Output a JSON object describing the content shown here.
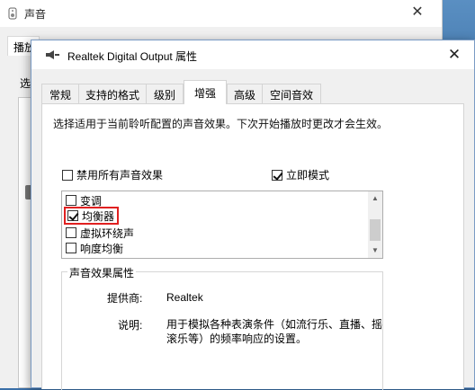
{
  "background_window": {
    "title": "声音",
    "tab_label": "播放",
    "label": "选"
  },
  "dialog": {
    "title": "Realtek Digital Output 属性",
    "tabs": [
      {
        "label": "常规",
        "active": false
      },
      {
        "label": "支持的格式",
        "active": false
      },
      {
        "label": "级别",
        "active": false
      },
      {
        "label": "增强",
        "active": true
      },
      {
        "label": "高级",
        "active": false
      },
      {
        "label": "空间音效",
        "active": false
      }
    ],
    "description": "选择适用于当前聆听配置的声音效果。下次开始播放时更改才会生效。",
    "disable_all": {
      "label": "禁用所有声音效果",
      "checked": false
    },
    "immediate_mode": {
      "label": "立即模式",
      "checked": true
    },
    "effects": [
      {
        "label": "变调",
        "checked": false
      },
      {
        "label": "均衡器",
        "checked": true
      },
      {
        "label": "虚拟环绕声",
        "checked": false
      },
      {
        "label": "响度均衡",
        "checked": false
      }
    ],
    "properties": {
      "group_title": "声音效果属性",
      "provider_label": "提供商:",
      "provider_value": "Realtek",
      "description_label": "说明:",
      "description_value": "用于模拟各种表演条件（如流行乐、直播、摇滚乐等）的频率响应的设置。"
    }
  },
  "colors": {
    "highlight_border": "#e02020",
    "desktop": "#2a5e95"
  }
}
